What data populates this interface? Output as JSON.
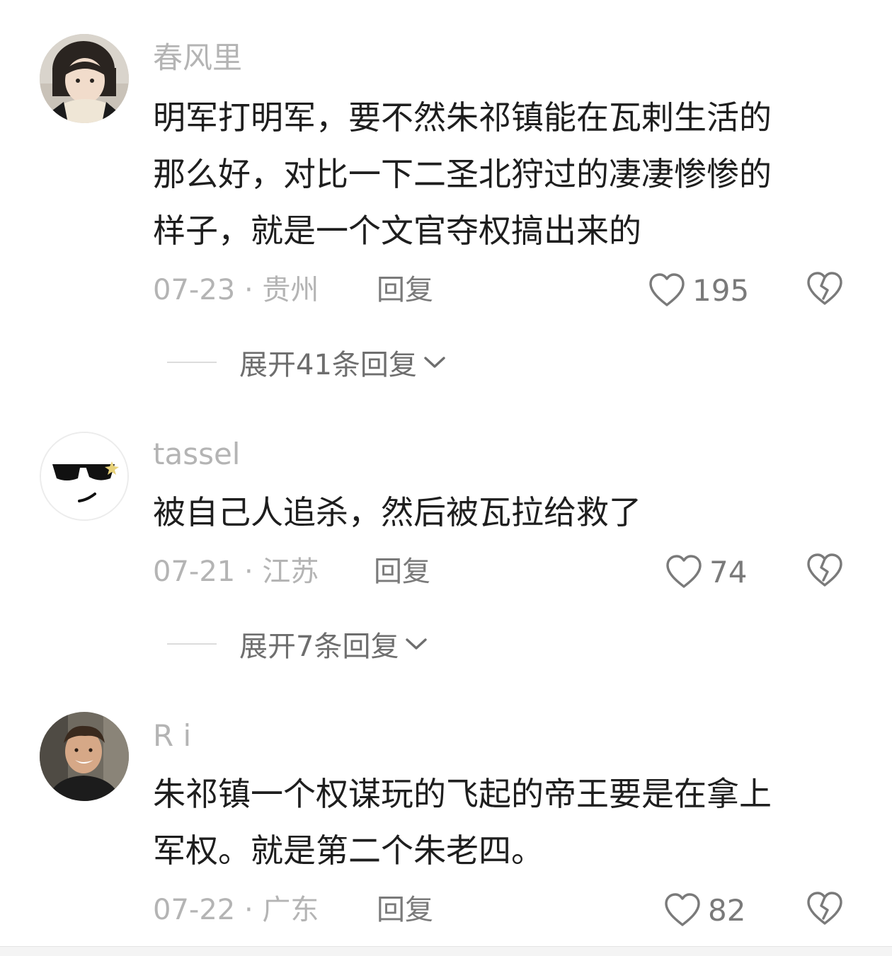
{
  "comments": [
    {
      "username": "春风里",
      "text_lines": [
        "明军打明军，要不然朱祁镇能在瓦剌生活的",
        "那么好，对比一下二圣北狩过的凄凄惨惨的",
        "样子，就是一个文官夺权搞出来的"
      ],
      "meta": "07-23 · 贵州",
      "reply_label": "回复",
      "likes": "195",
      "expand_label": "展开41条回复"
    },
    {
      "username": "tassel",
      "text_lines": [
        "被自己人追杀，然后被瓦拉给救了"
      ],
      "meta": "07-21 · 江苏",
      "reply_label": "回复",
      "likes": "74",
      "expand_label": "展开7条回复"
    },
    {
      "username": "R i",
      "text_lines": [
        "朱祁镇一个权谋玩的飞起的帝王要是在拿上",
        "军权。就是第二个朱老四。"
      ],
      "meta": "07-22 · 广东",
      "reply_label": "回复",
      "likes": "82"
    }
  ],
  "icons": {
    "like": "heart-outline-icon",
    "dislike": "broken-heart-icon",
    "expand": "chevron-down-icon"
  },
  "colors": {
    "text": "#1e1e1e",
    "secondary": "#b4b4b4",
    "action": "#7a7a7a"
  }
}
